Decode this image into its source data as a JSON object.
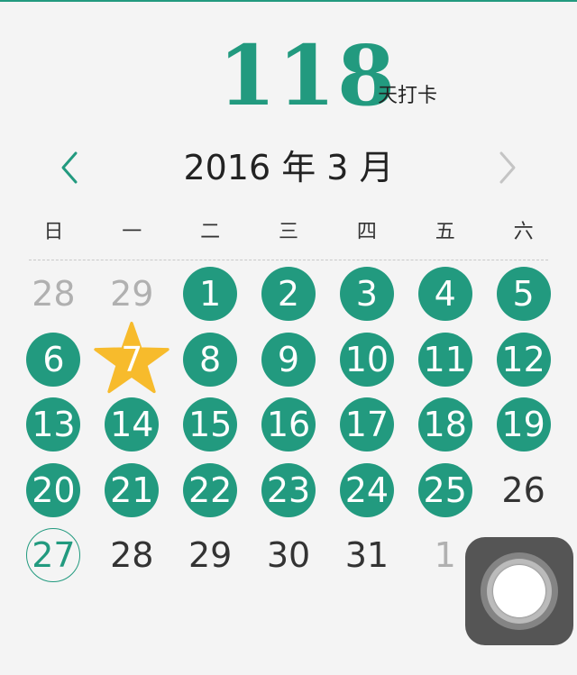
{
  "colors": {
    "accent": "#229a7f",
    "star": "#f7bb2c",
    "muted": "#b0b0b0",
    "text": "#333333"
  },
  "header": {
    "count": "118",
    "unit": "天打卡"
  },
  "month_bar": {
    "title": "2016 年 3 月",
    "prev_icon": "chevron-left-icon",
    "next_icon": "chevron-right-icon"
  },
  "weekdays": [
    "日",
    "一",
    "二",
    "三",
    "四",
    "五",
    "六"
  ],
  "weeks": [
    [
      {
        "d": "28",
        "s": "muted"
      },
      {
        "d": "29",
        "s": "muted"
      },
      {
        "d": "1",
        "s": "checked"
      },
      {
        "d": "2",
        "s": "checked"
      },
      {
        "d": "3",
        "s": "checked"
      },
      {
        "d": "4",
        "s": "checked"
      },
      {
        "d": "5",
        "s": "checked"
      }
    ],
    [
      {
        "d": "6",
        "s": "checked"
      },
      {
        "d": "7",
        "s": "starred"
      },
      {
        "d": "8",
        "s": "checked"
      },
      {
        "d": "9",
        "s": "checked"
      },
      {
        "d": "10",
        "s": "checked"
      },
      {
        "d": "11",
        "s": "checked"
      },
      {
        "d": "12",
        "s": "checked"
      }
    ],
    [
      {
        "d": "13",
        "s": "checked"
      },
      {
        "d": "14",
        "s": "checked"
      },
      {
        "d": "15",
        "s": "checked"
      },
      {
        "d": "16",
        "s": "checked"
      },
      {
        "d": "17",
        "s": "checked"
      },
      {
        "d": "18",
        "s": "checked"
      },
      {
        "d": "19",
        "s": "checked"
      }
    ],
    [
      {
        "d": "20",
        "s": "checked"
      },
      {
        "d": "21",
        "s": "checked"
      },
      {
        "d": "22",
        "s": "checked"
      },
      {
        "d": "23",
        "s": "checked"
      },
      {
        "d": "24",
        "s": "checked"
      },
      {
        "d": "25",
        "s": "checked"
      },
      {
        "d": "26",
        "s": "normal"
      }
    ],
    [
      {
        "d": "27",
        "s": "today"
      },
      {
        "d": "28",
        "s": "normal"
      },
      {
        "d": "29",
        "s": "normal"
      },
      {
        "d": "30",
        "s": "normal"
      },
      {
        "d": "31",
        "s": "normal"
      },
      {
        "d": "1",
        "s": "muted"
      },
      {
        "d": "",
        "s": "hidden"
      }
    ]
  ],
  "assistive_touch": {
    "icon": "assistive-touch-icon"
  }
}
